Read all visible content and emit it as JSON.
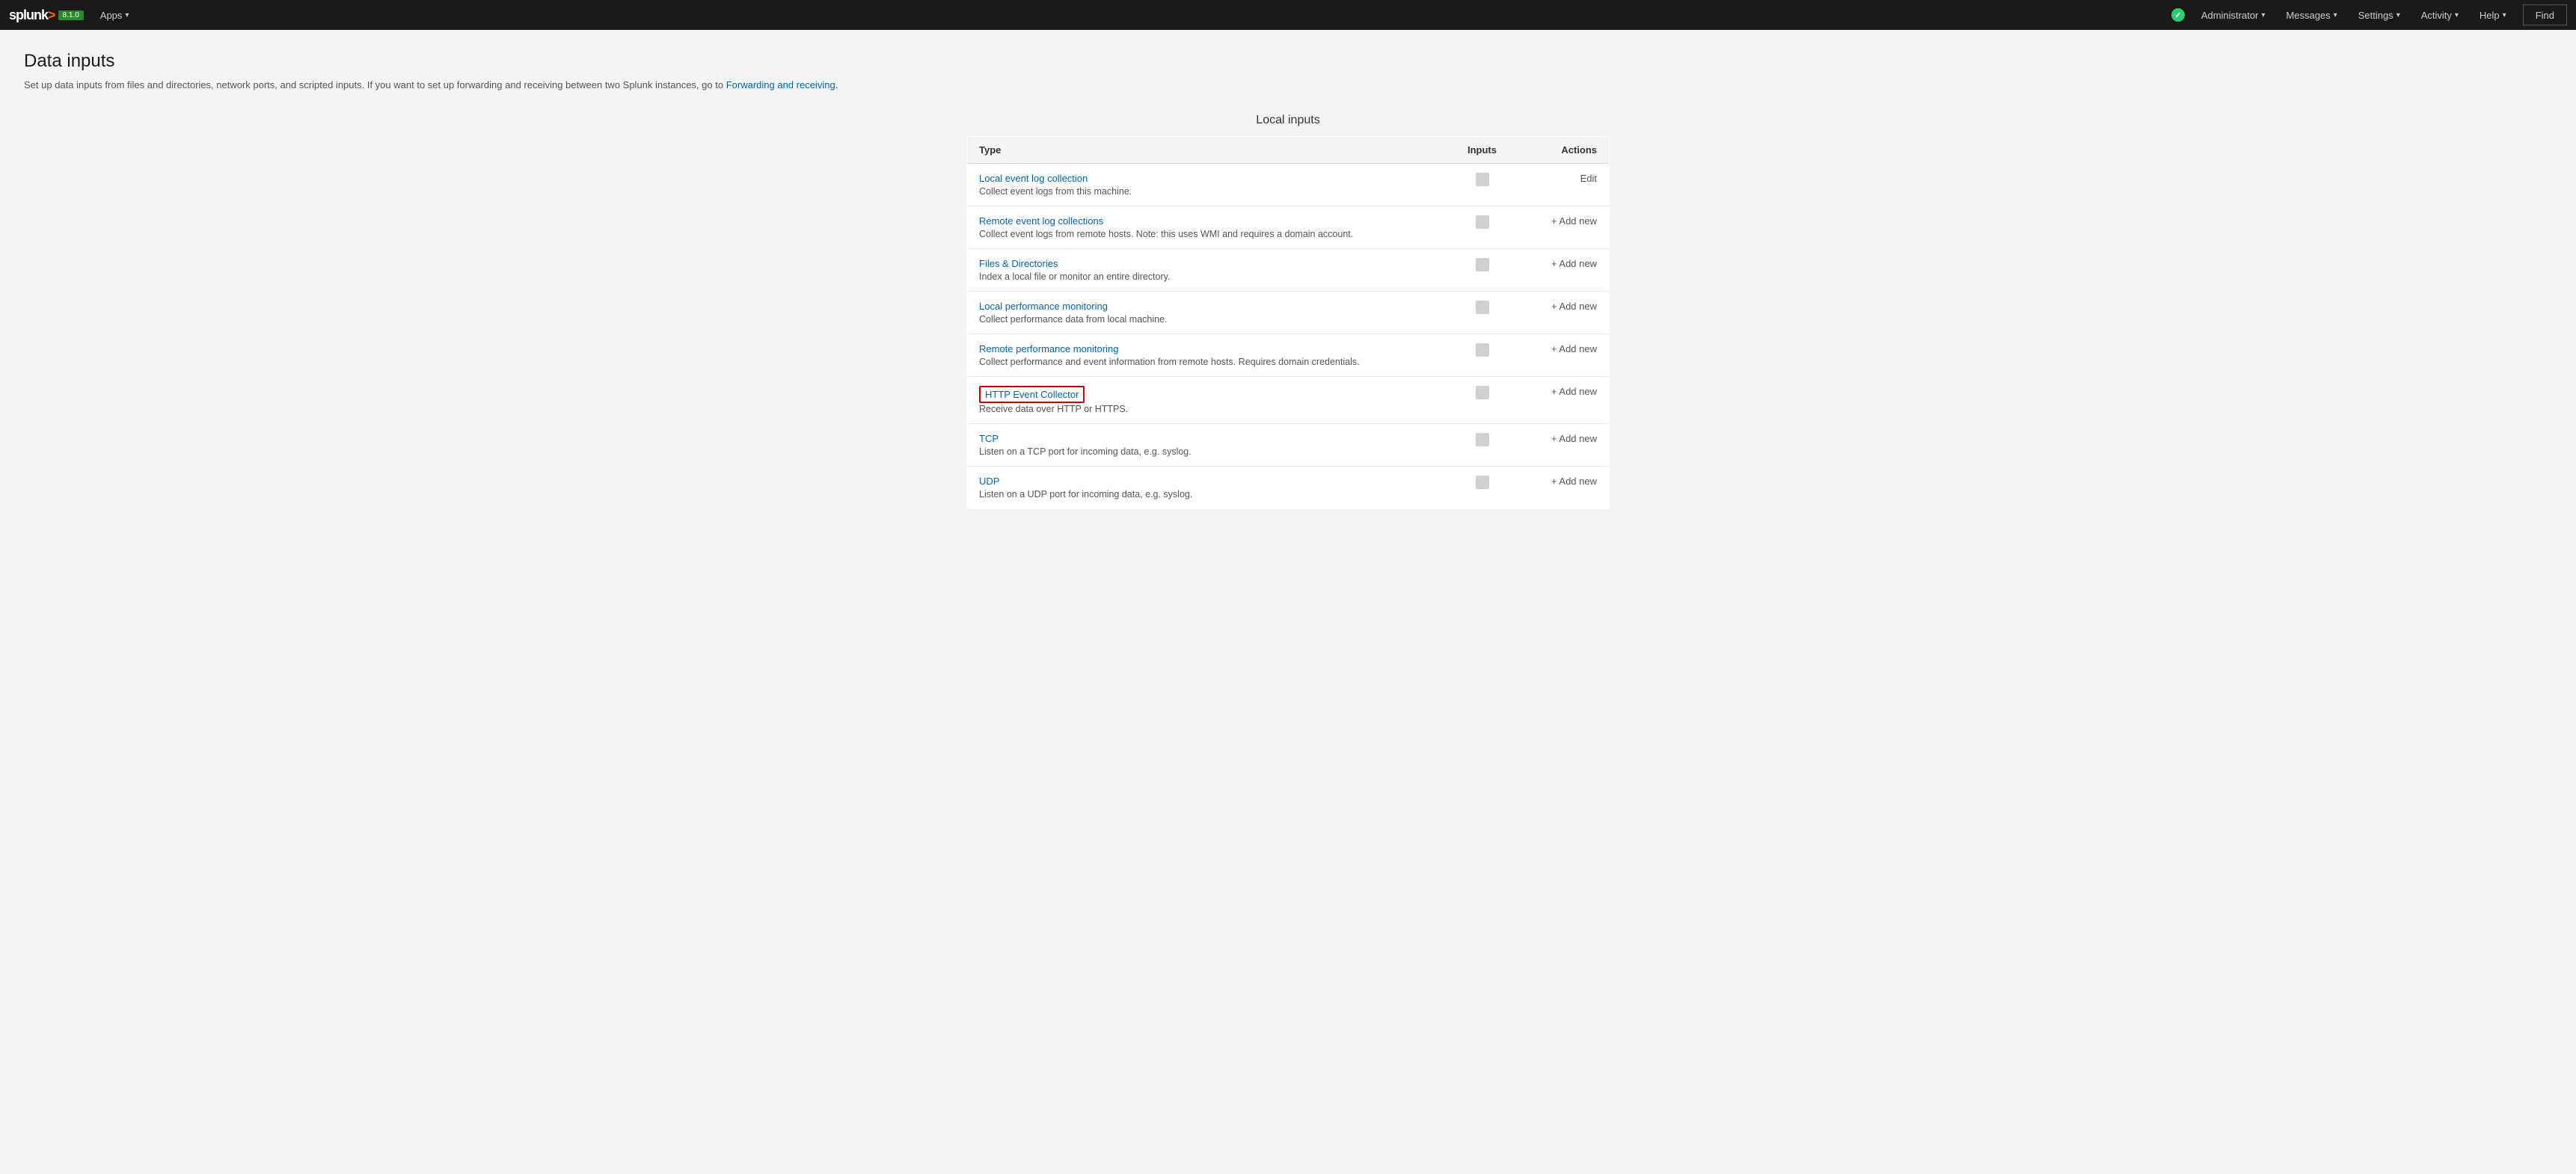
{
  "navbar": {
    "brand": "splunk",
    "brand_version": "8.1.0",
    "apps_label": "Apps",
    "apps_caret": "▾",
    "nav_right": [
      {
        "id": "administrator",
        "label": "Administrator",
        "caret": "▾"
      },
      {
        "id": "messages",
        "label": "Messages",
        "caret": "▾"
      },
      {
        "id": "settings",
        "label": "Settings",
        "caret": "▾"
      },
      {
        "id": "activity",
        "label": "Activity",
        "caret": "▾"
      },
      {
        "id": "help",
        "label": "Help",
        "caret": "▾"
      }
    ],
    "find_label": "Find"
  },
  "page": {
    "title": "Data inputs",
    "subtitle_text": "Set up data inputs from files and directories, network ports, and scripted inputs. If you want to set up forwarding and receiving between two Splunk instances, go to",
    "subtitle_link_text": "Forwarding and receiving",
    "subtitle_link_href": "#"
  },
  "local_inputs": {
    "section_title": "Local inputs",
    "table": {
      "headers": {
        "type": "Type",
        "inputs": "Inputs",
        "actions": "Actions"
      },
      "rows": [
        {
          "id": "local-event-log",
          "link": "Local event log collection",
          "desc": "Collect event logs from this machine.",
          "inputs_count": "",
          "action_type": "edit",
          "action_label": "Edit",
          "highlighted": false
        },
        {
          "id": "remote-event-log",
          "link": "Remote event log collections",
          "desc": "Collect event logs from remote hosts. Note: this uses WMI and requires a domain account.",
          "inputs_count": "",
          "action_type": "add",
          "action_label": "+ Add new",
          "highlighted": false
        },
        {
          "id": "files-directories",
          "link": "Files & Directories",
          "desc": "Index a local file or monitor an entire directory.",
          "inputs_count": "",
          "action_type": "add",
          "action_label": "+ Add new",
          "highlighted": false
        },
        {
          "id": "local-performance",
          "link": "Local performance monitoring",
          "desc": "Collect performance data from local machine.",
          "inputs_count": "",
          "action_type": "add",
          "action_label": "+ Add new",
          "highlighted": false
        },
        {
          "id": "remote-performance",
          "link": "Remote performance monitoring",
          "desc": "Collect performance and event information from remote hosts. Requires domain credentials.",
          "inputs_count": "",
          "action_type": "add",
          "action_label": "+ Add new",
          "highlighted": false
        },
        {
          "id": "http-event-collector",
          "link": "HTTP Event Collector",
          "desc": "Receive data over HTTP or HTTPS.",
          "inputs_count": "",
          "action_type": "add",
          "action_label": "+ Add new",
          "highlighted": true
        },
        {
          "id": "tcp",
          "link": "TCP",
          "desc": "Listen on a TCP port for incoming data, e.g. syslog.",
          "inputs_count": "",
          "action_type": "add",
          "action_label": "+ Add new",
          "highlighted": false
        },
        {
          "id": "udp",
          "link": "UDP",
          "desc": "Listen on a UDP port for incoming data, e.g. syslog.",
          "inputs_count": "",
          "action_type": "add",
          "action_label": "+ Add new",
          "highlighted": false
        }
      ]
    }
  }
}
